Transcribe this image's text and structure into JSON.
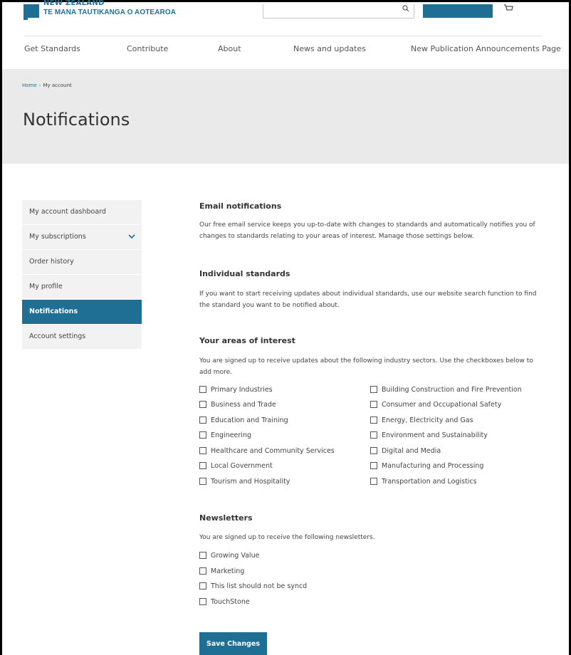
{
  "header": {
    "logo_line1": "NEW ZEALAND",
    "logo_line2": "TE MANA TAUTIKANGA O AOTEAROA",
    "nav": [
      "Get Standards",
      "Contribute",
      "About",
      "News and updates",
      "New Publication Announcements Page"
    ]
  },
  "breadcrumb": {
    "home": "Home",
    "separator": "›",
    "current": "My account"
  },
  "page_title": "Notifications",
  "sidebar": {
    "items": [
      {
        "label": "My account dashboard",
        "active": false
      },
      {
        "label": "My subscriptions",
        "active": false,
        "expandable": true
      },
      {
        "label": "Order history",
        "active": false
      },
      {
        "label": "My profile",
        "active": false
      },
      {
        "label": "Notifications",
        "active": true
      },
      {
        "label": "Account settings",
        "active": false
      }
    ]
  },
  "email": {
    "heading": "Email notifications",
    "text": "Our free email service keeps you up-to-date with changes to standards and automatically notifies you of changes to standards relating to your areas of interest. Manage those settings below."
  },
  "individual": {
    "heading": "Individual standards",
    "text": "If you want to start receiving updates about individual standards, use our website search function to find the standard you want to be notified about."
  },
  "interests": {
    "heading": "Your areas of interest",
    "text": "You are signed up to receive updates about the following industry sectors. Use the checkboxes below to add more.",
    "left": [
      "Primary Industries",
      "Business and Trade",
      "Education and Training",
      "Engineering",
      "Healthcare and Community Services",
      "Local Government",
      "Tourism and Hospitality"
    ],
    "right": [
      "Building Construction and Fire Prevention",
      "Consumer and Occupational Safety",
      "Energy, Electricity and Gas",
      "Environment and Sustainability",
      "Digital and Media",
      "Manufacturing and Processing",
      "Transportation and Logistics"
    ]
  },
  "newsletters": {
    "heading": "Newsletters",
    "text": "You are signed up to receive the following newsletters.",
    "items": [
      "Growing Value",
      "Marketing",
      "This list should not be syncd",
      "TouchStone"
    ]
  },
  "save_label": "Save Changes",
  "colors": {
    "brand": "#1f6f94",
    "banner": "#eaeaea",
    "sidebar": "#f2f2f2"
  }
}
